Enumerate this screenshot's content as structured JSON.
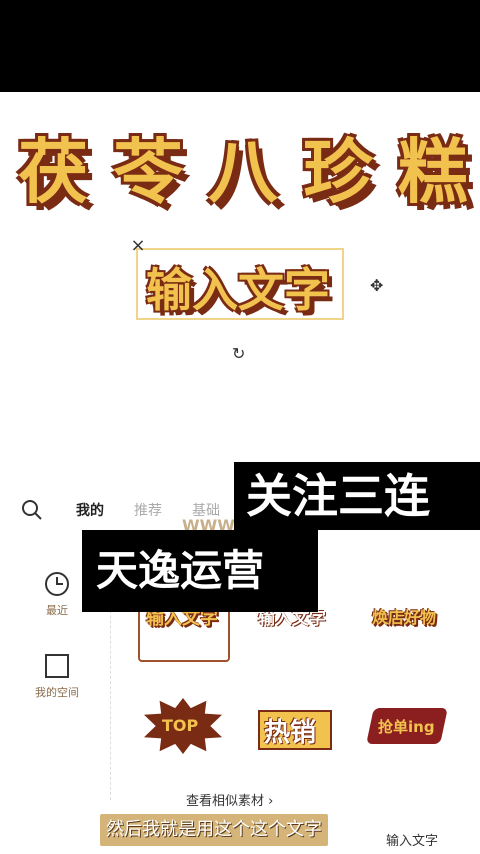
{
  "canvas": {
    "big_title_chars": [
      "茯",
      "苓",
      "八",
      "珍",
      "糕"
    ],
    "selected_text": "输入文字"
  },
  "overlays": {
    "top_caption": "关注三连",
    "mid_caption": "天逸运营",
    "subtitle": "然后我就是用这个这个文字"
  },
  "panel": {
    "tabs": [
      "我的",
      "推荐",
      "基础"
    ],
    "sidebar": [
      {
        "label": "最近",
        "icon": "clock-icon"
      },
      {
        "label": "我的空间",
        "icon": "folder-icon"
      }
    ],
    "watermark": "WWW",
    "materials_row1": [
      "输入文字",
      "输入文字",
      "焕店好物"
    ],
    "materials_row2": [
      "TOP",
      "热销",
      "抢单ing"
    ],
    "more_link": "查看相似素材 ›",
    "bottom_text": "输入文字"
  },
  "colors": {
    "accent_yellow": "#f2c24f",
    "accent_brown": "#7a2b14",
    "subtitle_bg": "#d4b478"
  }
}
